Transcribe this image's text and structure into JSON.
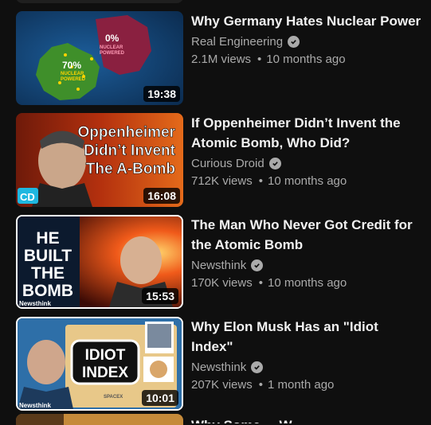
{
  "videos": [
    {
      "title": "Why Germany Hates Nuclear Power",
      "channel": "Real Engineering",
      "views": "2.1M views",
      "age": "10 months ago",
      "duration": "19:38",
      "thumb_text": [
        "0%",
        "NUCLEAR",
        "POWERED",
        "70%",
        "NUCLEAR",
        "POWERED"
      ]
    },
    {
      "title": "If Oppenheimer Didn’t Invent the Atomic Bomb, Who Did?",
      "channel": "Curious Droid",
      "views": "712K views",
      "age": "10 months ago",
      "duration": "16:08",
      "thumb_text": [
        "Oppenheimer",
        "Didn’t Invent",
        "The A-Bomb",
        "CD"
      ]
    },
    {
      "title": "The Man Who Never Got Credit for the Atomic Bomb",
      "channel": "Newsthink",
      "views": "170K views",
      "age": "10 months ago",
      "duration": "15:53",
      "thumb_text": [
        "HE",
        "BUILT",
        "THE",
        "BOMB",
        "Newsthink"
      ]
    },
    {
      "title": "Why Elon Musk Has an \"Idiot Index\"",
      "channel": "Newsthink",
      "views": "207K views",
      "age": "1 month ago",
      "duration": "10:01",
      "thumb_text": [
        "IDIOT",
        "INDEX",
        "SPACEX",
        "Newsthink"
      ]
    }
  ],
  "next_title_partial": "Why Some ... W..."
}
